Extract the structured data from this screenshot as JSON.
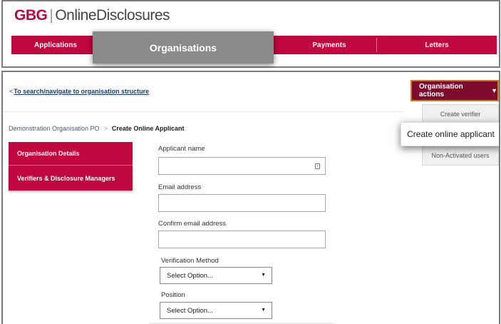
{
  "logo": {
    "brand": "GBG",
    "separator": "|",
    "product": "OnlineDisclosures"
  },
  "nav": {
    "items": [
      "Applications",
      "Organisations",
      "Payments",
      "Letters"
    ],
    "active": "Organisations"
  },
  "back_link": {
    "chevron": "<",
    "label": "To search/navigate to organisation structure"
  },
  "org_actions": {
    "label": "Organisation actions",
    "caret": "▼",
    "menu": [
      "Create verifier",
      "Create online applicant",
      "Non-Activated users"
    ],
    "highlighted": "Create online applicant"
  },
  "breadcrumb": {
    "parent": "Demonstration Organisation PO",
    "separator": ">",
    "current": "Create Online Applicant"
  },
  "side_menu": [
    "Organisation Details",
    "Verifiers & Disclosure Managers"
  ],
  "form": {
    "applicant_name_label": "Applicant name",
    "applicant_name_value": "",
    "email_label": "Email address",
    "email_value": "",
    "confirm_email_label": "Confirm email address",
    "confirm_email_value": "",
    "verification_label": "Verification Method",
    "verification_value": "Select Option...",
    "position_label": "Position",
    "position_value": "Select Option...",
    "select_caret": "▼"
  },
  "colors": {
    "brand": "#c1073f",
    "actions_bg": "#7e0b2c",
    "active_tab": "#8a8a8a",
    "link": "#1d3a6a"
  }
}
